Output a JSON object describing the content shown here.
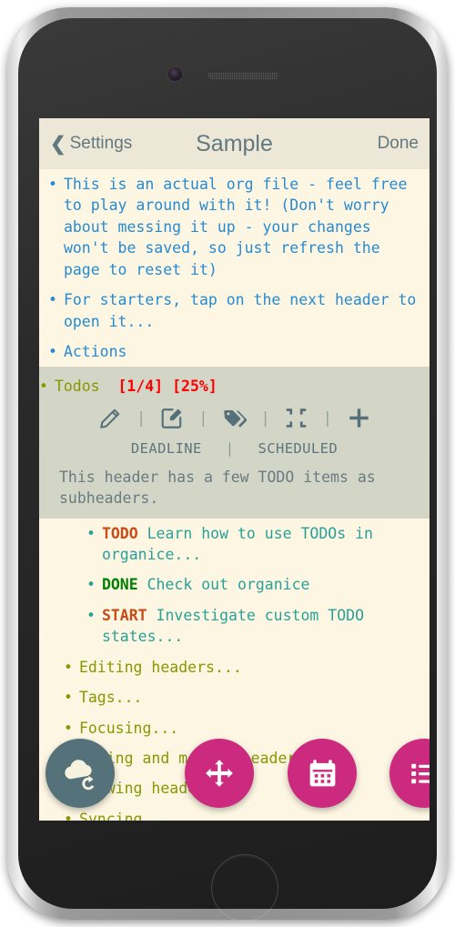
{
  "device": {
    "type": "smartphone-mockup",
    "camera": "camera-icon",
    "speaker": "speaker-grille"
  },
  "navbar": {
    "back_icon": "chevron-left-icon",
    "back_label": "Settings",
    "title": "Sample",
    "done_label": "Done"
  },
  "colors": {
    "screen_bg": "#fdf6e3",
    "navbar_bg": "#ece7d6",
    "selected_bg": "#d3d6c7",
    "blue": "#268bd2",
    "olive": "#859900",
    "teal": "#2aa198",
    "slate": "#64757b",
    "red": "#ff0000",
    "orange": "#cb4b16",
    "green": "#008000",
    "fab_pink": "#cc2a7f",
    "fab_sync": "#55717a"
  },
  "content": {
    "intro_items": [
      {
        "bullet": "•",
        "text": "This is an actual org file - feel free to play around with it! (Don't worry about messing it up - your changes won't be saved, so just refresh the page to reset it)"
      },
      {
        "bullet": "•",
        "text": "For starters, tap on the next header to open it..."
      },
      {
        "bullet": "•",
        "text": "Actions"
      }
    ],
    "selected_header": {
      "bullet": "•",
      "title": "Todos",
      "progress_count": "[1/4]",
      "progress_percent": "[25%]",
      "toolbar": [
        {
          "name": "pencil-icon",
          "sep": "|"
        },
        {
          "name": "edit-note-icon",
          "sep": "|"
        },
        {
          "name": "tags-icon",
          "sep": "|"
        },
        {
          "name": "compress-icon",
          "sep": "|"
        },
        {
          "name": "plus-icon",
          "sep": ""
        }
      ],
      "planning": {
        "deadline_label": "DEADLINE",
        "separator": "|",
        "scheduled_label": "SCHEDULED"
      },
      "description": "This header has a few TODO items as subheaders."
    },
    "todo_items": [
      {
        "bullet": "•",
        "keyword": "TODO",
        "keyword_color": "orange",
        "text": "Learn how to use TODOs in organice..."
      },
      {
        "bullet": "•",
        "keyword": "DONE",
        "keyword_color": "green",
        "text": "Check out organice"
      },
      {
        "bullet": "•",
        "keyword": "START",
        "keyword_color": "orange",
        "text": "Investigate custom TODO states..."
      }
    ],
    "outline_items": [
      {
        "bullet": "•",
        "text": "Editing headers..."
      },
      {
        "bullet": "•",
        "text": "Tags..."
      },
      {
        "bullet": "•",
        "text": "Focusing..."
      },
      {
        "bullet": "•",
        "text": "Adding and moving headers..."
      },
      {
        "bullet": "•",
        "text": "Viewing headers..."
      },
      {
        "bullet": "•",
        "text": "Syncing"
      }
    ]
  },
  "fabs": [
    {
      "name": "cloud-sync-fab",
      "icon": "cloud-sync-icon",
      "color": "#55717a"
    },
    {
      "name": "move-fab",
      "icon": "arrows-move-icon",
      "color": "#cc2a7f"
    },
    {
      "name": "schedule-fab",
      "icon": "calendar-icon",
      "color": "#cc2a7f"
    },
    {
      "name": "list-view-fab",
      "icon": "list-icon",
      "color": "#cc2a7f"
    }
  ]
}
